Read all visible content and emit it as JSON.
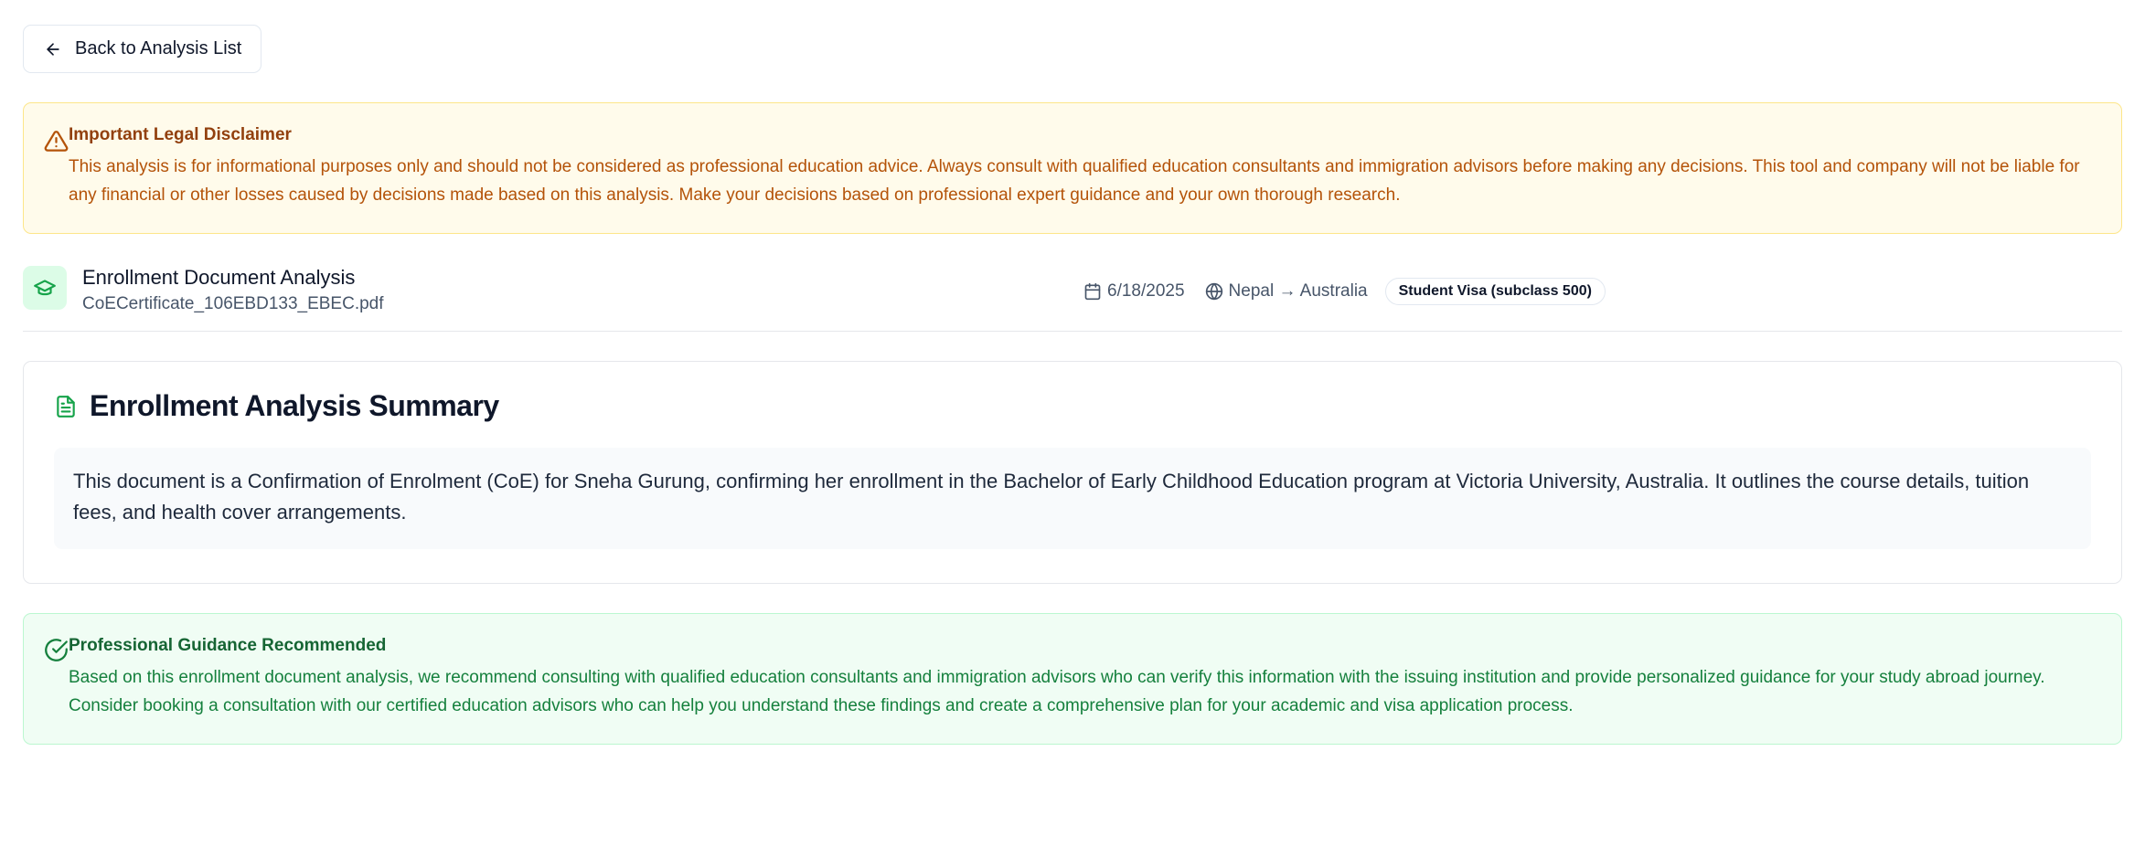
{
  "back_button": {
    "label": "Back to Analysis List"
  },
  "disclaimer": {
    "title": "Important Legal Disclaimer",
    "text": "This analysis is for informational purposes only and should not be considered as professional education advice. Always consult with qualified education consultants and immigration advisors before making any decisions. This tool and company will not be liable for any financial or other losses caused by decisions made based on this analysis. Make your decisions based on professional expert guidance and your own thorough research."
  },
  "document": {
    "title": "Enrollment Document Analysis",
    "file_name": "CoECertificate_106EBD133_EBEC.pdf",
    "date": "6/18/2025",
    "route": "Nepal → Australia",
    "visa_type": "Student Visa (subclass 500)"
  },
  "summary": {
    "title": "Enrollment Analysis Summary",
    "text": "This document is a Confirmation of Enrolment (CoE) for Sneha Gurung, confirming her enrollment in the Bachelor of Early Childhood Education program at Victoria University, Australia. It outlines the course details, tuition fees, and health cover arrangements."
  },
  "guidance": {
    "title": "Professional Guidance Recommended",
    "text": "Based on this enrollment document analysis, we recommend consulting with qualified education consultants and immigration advisors who can verify this information with the issuing institution and provide personalized guidance for your study abroad journey. Consider booking a consultation with our certified education advisors who can help you understand these findings and create a comprehensive plan for your academic and visa application process."
  },
  "colors": {
    "warning_bg": "#fffbeb",
    "warning_text": "#b45309",
    "success_bg": "#f0fdf4",
    "success_text": "#15803d",
    "accent_green": "#16a34a"
  },
  "icons": {
    "back": "arrow-left-icon",
    "warning": "alert-triangle-icon",
    "document_type": "graduation-cap-icon",
    "date": "calendar-icon",
    "route": "globe-icon",
    "summary": "file-text-icon",
    "guidance": "check-circle-icon"
  }
}
